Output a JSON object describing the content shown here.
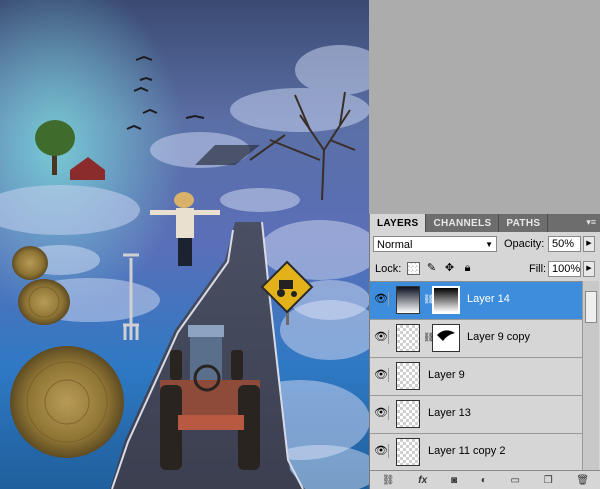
{
  "panel": {
    "tabs": [
      {
        "label": "LAYERS"
      },
      {
        "label": "CHANNELS"
      },
      {
        "label": "PATHS"
      }
    ],
    "menu_icon": "panel-menu-icon",
    "blend_mode": "Normal",
    "opacity_label": "Opacity:",
    "opacity_value": "50%",
    "lock_label": "Lock:",
    "fill_label": "Fill:",
    "fill_value": "100%",
    "layers": [
      {
        "name": "Layer 14",
        "selected": true
      },
      {
        "name": "Layer 9 copy",
        "selected": false
      },
      {
        "name": "Layer 9",
        "selected": false
      },
      {
        "name": "Layer 13",
        "selected": false
      },
      {
        "name": "Layer 11 copy 2",
        "selected": false
      }
    ],
    "bottom_icons": [
      "link-icon",
      "fx-icon",
      "mask-icon",
      "adjustment-icon",
      "folder-icon",
      "new-layer-icon",
      "trash-icon"
    ],
    "fx_label": "fx"
  },
  "canvas": {
    "road_sign_color": "#e3b21a",
    "sky_color": "#3e4f7a"
  }
}
